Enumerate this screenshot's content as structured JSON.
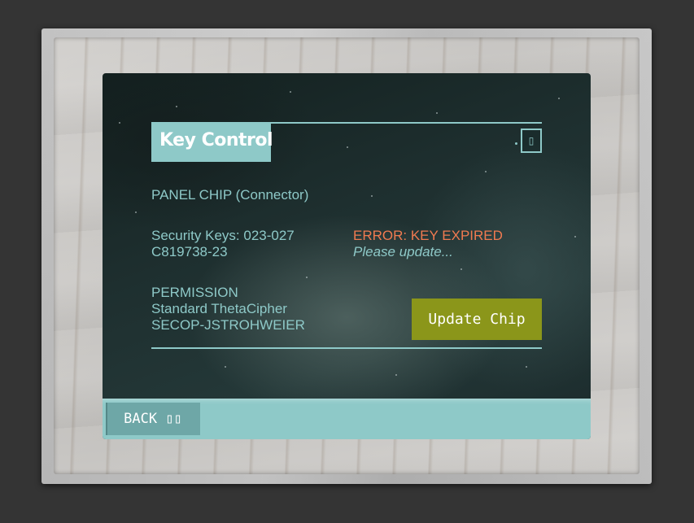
{
  "panel": {
    "title": "Key Control",
    "corner_button_glyph": "▯",
    "chip_label": "PANEL CHIP (Connector)",
    "security_keys_line1": "Security Keys: 023-027",
    "security_keys_line2": "C819738-23",
    "error_title": "ERROR: KEY EXPIRED",
    "error_message": "Please update...",
    "permission_heading": "PERMISSION",
    "permission_type": "Standard ThetaCipher",
    "permission_user": "SECOP-JSTROHWEIER",
    "update_button_label": "Update Chip"
  },
  "footer": {
    "back_button_label": "BACK ▯▯"
  },
  "colors": {
    "accent_teal": "#8ec9c8",
    "error_orange": "#f07a50",
    "update_button_olive": "#8b961a",
    "back_button_teal": "#6ea7a7"
  },
  "icons": {
    "corner_button": "panel-toggle-icon",
    "back_button": "back-arrow-icon"
  }
}
